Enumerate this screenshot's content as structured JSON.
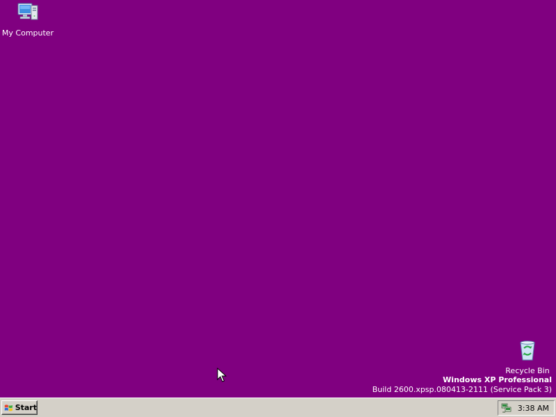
{
  "desktop": {
    "background_color": "#800080",
    "icons": [
      {
        "label": "My Computer",
        "icon": "my-computer-icon"
      },
      {
        "label": "Recycle Bin",
        "icon": "recycle-bin-icon"
      }
    ]
  },
  "watermark": {
    "edition": "Windows XP Professional",
    "build": "Build 2600.xpsp.080413-2111 (Service Pack 3)"
  },
  "taskbar": {
    "start_label": "Start",
    "start_icon": "windows-logo-icon",
    "tray": {
      "icon": "network-icon",
      "clock": "3:38 AM"
    }
  }
}
